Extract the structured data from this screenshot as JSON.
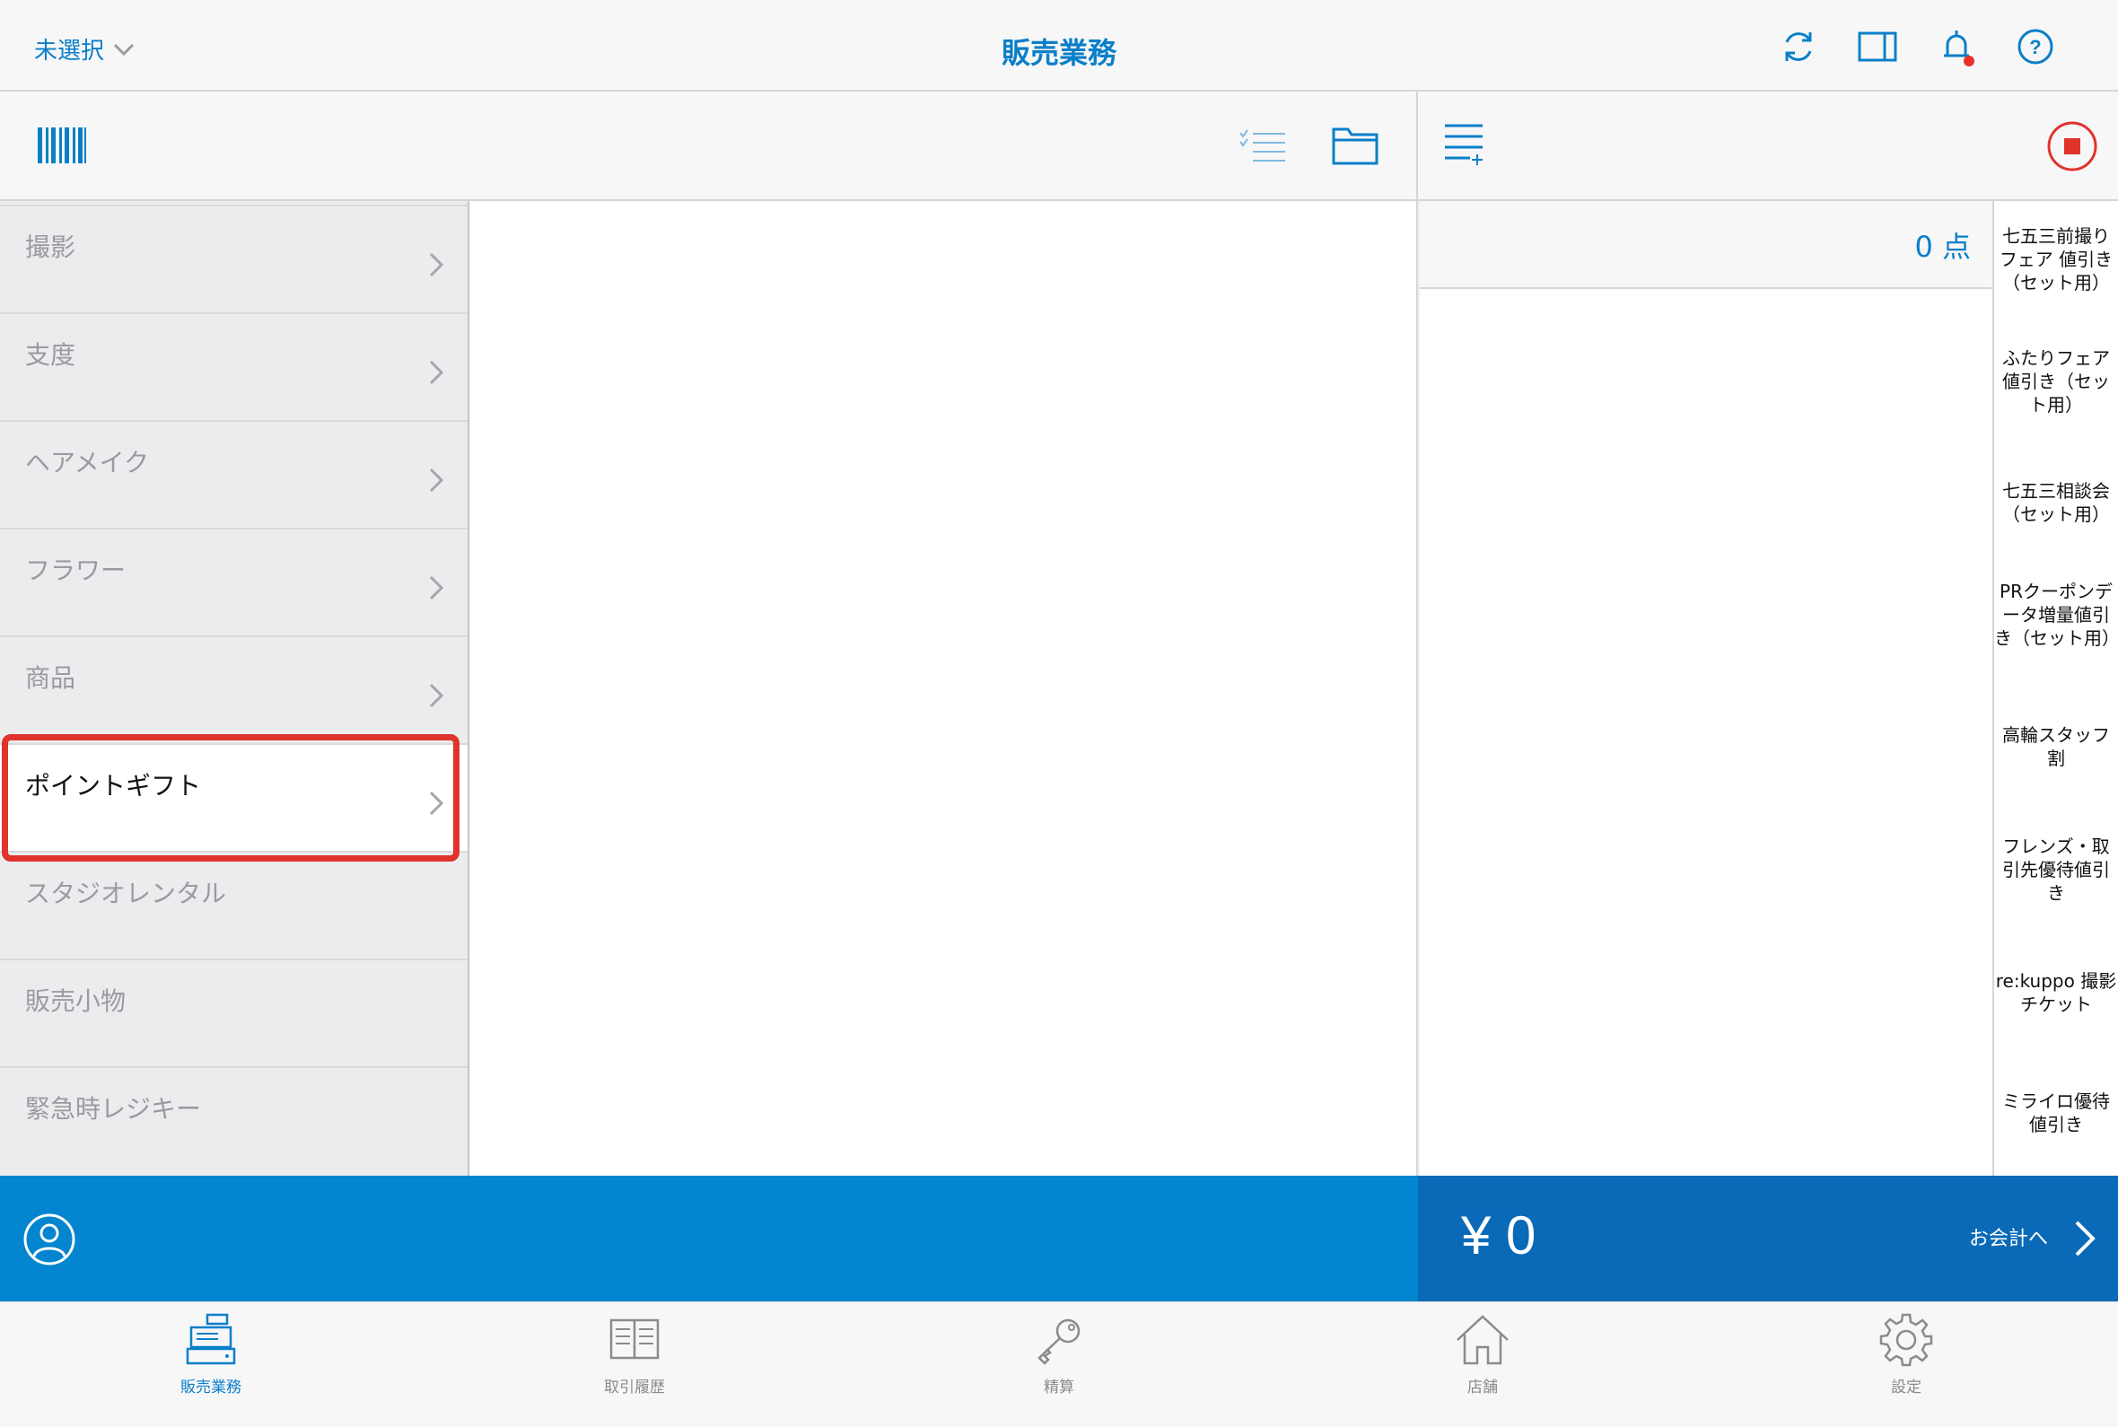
{
  "header": {
    "store_select_label": "未選択",
    "title": "販売業務",
    "icons": [
      "sync-icon",
      "split-view-icon",
      "bell-icon",
      "help-icon"
    ]
  },
  "categories": {
    "items": [
      {
        "label": "撮影",
        "selected": false
      },
      {
        "label": "支度",
        "selected": false
      },
      {
        "label": "ヘアメイク",
        "selected": false
      },
      {
        "label": "フラワー",
        "selected": false
      },
      {
        "label": "商品",
        "selected": false
      },
      {
        "label": "ポイントギフト",
        "selected": true
      },
      {
        "label": "スタジオレンタル",
        "selected": false
      },
      {
        "label": "販売小物",
        "selected": false
      },
      {
        "label": "緊急時レジキー",
        "selected": false
      }
    ]
  },
  "cart": {
    "count_label": "0 点"
  },
  "discounts": {
    "items": [
      "七五三前撮りフェア 値引き（セット用）",
      "ふたりフェア値引き（セット用）",
      "七五三相談会（セット用）",
      "PRクーポンデータ増量値引き（セット用）",
      "高輪スタッフ割",
      "フレンズ・取引先優待値引き",
      "re:kuppo 撮影チケット",
      "ミライロ優待値引き"
    ]
  },
  "totals": {
    "amount": "¥ 0",
    "checkout_label": "お会計へ"
  },
  "tabs": [
    {
      "label": "販売業務",
      "icon": "register-icon",
      "active": true
    },
    {
      "label": "取引履歴",
      "icon": "book-icon",
      "active": false
    },
    {
      "label": "精算",
      "icon": "key-icon",
      "active": false
    },
    {
      "label": "店舗",
      "icon": "home-icon",
      "active": false
    },
    {
      "label": "設定",
      "icon": "gear-icon",
      "active": false
    }
  ],
  "colors": {
    "accent": "#0a7fc8",
    "bottom_bar": "#0385d0",
    "total_bar": "#0a6ab8",
    "highlight": "#e0332b",
    "notification": "#e8302a"
  }
}
